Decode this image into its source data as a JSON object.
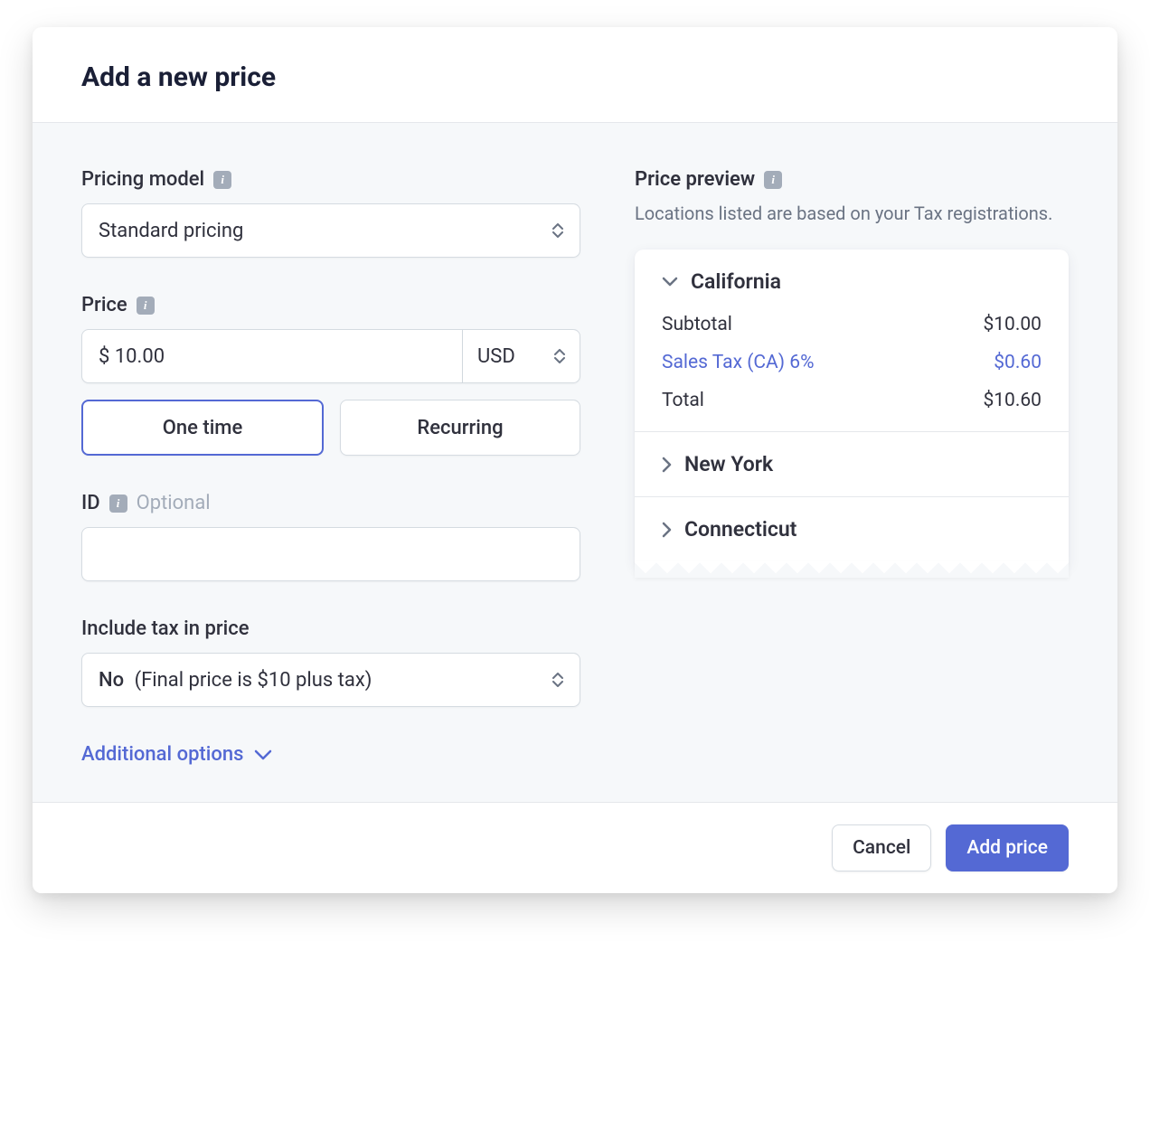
{
  "header": {
    "title": "Add a new price"
  },
  "form": {
    "pricing_model": {
      "label": "Pricing model",
      "value": "Standard pricing"
    },
    "price": {
      "label": "Price",
      "value": "$ 10.00",
      "currency": "USD",
      "type_options": {
        "one_time": "One time",
        "recurring": "Recurring"
      }
    },
    "id": {
      "label": "ID",
      "optional": "Optional",
      "value": ""
    },
    "include_tax": {
      "label": "Include tax in price",
      "value_bold": "No",
      "value_detail": "(Final price is $10 plus tax)"
    },
    "additional_options_label": "Additional options"
  },
  "preview": {
    "heading": "Price preview",
    "note": "Locations listed are based on your Tax registrations.",
    "regions": {
      "california": {
        "name": "California",
        "lines": {
          "subtotal": {
            "label": "Subtotal",
            "value": "$10.00"
          },
          "tax": {
            "label": "Sales Tax (CA) 6%",
            "value": "$0.60"
          },
          "total": {
            "label": "Total",
            "value": "$10.60"
          }
        }
      },
      "new_york": {
        "name": "New York"
      },
      "connecticut": {
        "name": "Connecticut"
      }
    }
  },
  "footer": {
    "cancel": "Cancel",
    "submit": "Add price"
  }
}
